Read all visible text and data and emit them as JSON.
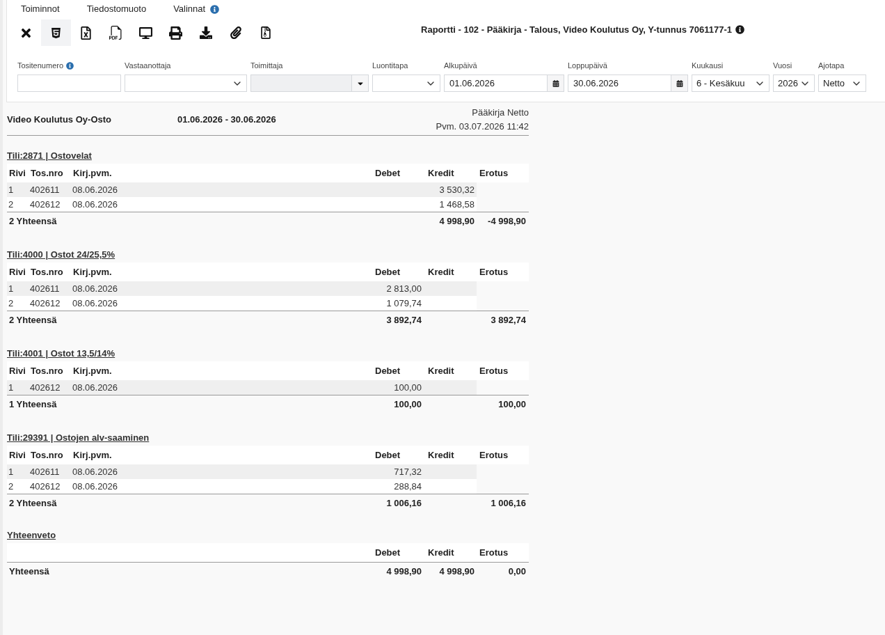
{
  "menu": [
    {
      "label": "Toiminnot",
      "info": false
    },
    {
      "label": "Tiedostomuoto",
      "info": false
    },
    {
      "label": "Valinnat",
      "info": true
    }
  ],
  "toolbar": [
    {
      "kind": "close",
      "selected": false
    },
    {
      "kind": "html",
      "selected": true
    },
    {
      "kind": "excel",
      "selected": false
    },
    {
      "kind": "pdf",
      "selected": false
    },
    {
      "kind": "screen",
      "selected": false
    },
    {
      "kind": "print",
      "selected": false
    },
    {
      "kind": "download",
      "selected": false
    },
    {
      "kind": "attach",
      "selected": false
    },
    {
      "kind": "file",
      "selected": false
    }
  ],
  "title": {
    "text": "Raportti - 102 - Pääkirja - Talous, Video Koulutus Oy, Y-tunnus 7061177-1",
    "info": true
  },
  "filters": [
    {
      "label": "Tositenumero",
      "info": true,
      "kind": "text",
      "disabled": false
    },
    {
      "label": "Vastaanottaja",
      "info": false,
      "kind": "select",
      "disabled": false
    },
    {
      "label": "Toimittaja",
      "info": false,
      "kind": "combo",
      "disabled": true
    },
    {
      "label": "Luontitapa",
      "info": false,
      "kind": "select",
      "disabled": false
    },
    {
      "label": "Alkupäivä",
      "info": false,
      "kind": "date",
      "value": "01.06.2026",
      "disabled": false
    },
    {
      "label": "Loppupäivä",
      "info": false,
      "kind": "date",
      "value": "30.06.2026",
      "disabled": false
    },
    {
      "label": "Kuukausi",
      "info": false,
      "kind": "select",
      "value": "6 - Kesäkuu",
      "disabled": false
    },
    {
      "label": "Vuosi",
      "info": false,
      "kind": "select",
      "value": "2026",
      "disabled": false
    },
    {
      "label": "Ajotapa",
      "info": false,
      "kind": "select",
      "value": "Netto",
      "disabled": false
    }
  ],
  "report": {
    "company": "Video Koulutus Oy-Osto",
    "period": "01.06.2026 - 30.06.2026",
    "report_name": "Pääkirja Netto",
    "printed": "Pvm. 03.07.2026 11:42"
  },
  "accounts": [
    {
      "title": "Tili:2871 | Ostovelat",
      "columns": [
        "Rivi",
        "Tos.nro",
        "Kirj.pvm.",
        "Debet",
        "Kredit",
        "Erotus"
      ],
      "rows": [
        {
          "rivi": "1",
          "tos_nro": "402611",
          "kirj_pvm": "08.06.2026",
          "kredit": "3 530,32"
        },
        {
          "rivi": "2",
          "tos_nro": "402612",
          "kirj_pvm": "08.06.2026",
          "kredit": "1 468,58"
        }
      ],
      "total": {
        "label": "2 Yhteensä",
        "kredit": "4 998,90",
        "erotus": "-4 998,90"
      }
    },
    {
      "title": "Tili:4000 | Ostot 24/25,5%",
      "columns": [
        "Rivi",
        "Tos.nro",
        "Kirj.pvm.",
        "Debet",
        "Kredit",
        "Erotus"
      ],
      "rows": [
        {
          "rivi": "1",
          "tos_nro": "402611",
          "kirj_pvm": "08.06.2026",
          "debet": "2 813,00"
        },
        {
          "rivi": "2",
          "tos_nro": "402612",
          "kirj_pvm": "08.06.2026",
          "debet": "1 079,74"
        }
      ],
      "total": {
        "label": "2 Yhteensä",
        "debet": "3 892,74",
        "erotus": "3 892,74"
      }
    },
    {
      "title": "Tili:4001 | Ostot 13,5/14%",
      "columns": [
        "Rivi",
        "Tos.nro",
        "Kirj.pvm.",
        "Debet",
        "Kredit",
        "Erotus"
      ],
      "rows": [
        {
          "rivi": "1",
          "tos_nro": "402612",
          "kirj_pvm": "08.06.2026",
          "debet": "100,00"
        }
      ],
      "total": {
        "label": "1 Yhteensä",
        "debet": "100,00",
        "erotus": "100,00"
      }
    },
    {
      "title": "Tili:29391 | Ostojen alv-saaminen",
      "columns": [
        "Rivi",
        "Tos.nro",
        "Kirj.pvm.",
        "Debet",
        "Kredit",
        "Erotus"
      ],
      "rows": [
        {
          "rivi": "1",
          "tos_nro": "402611",
          "kirj_pvm": "08.06.2026",
          "debet": "717,32"
        },
        {
          "rivi": "2",
          "tos_nro": "402612",
          "kirj_pvm": "08.06.2026",
          "debet": "288,84"
        }
      ],
      "total": {
        "label": "2 Yhteensä",
        "debet": "1 006,16",
        "erotus": "1 006,16"
      }
    }
  ],
  "summary": {
    "title": "Yhteenveto",
    "columns": [
      "Debet",
      "Kredit",
      "Erotus"
    ],
    "total": {
      "label": "Yhteensä",
      "debet": "4 998,90",
      "kredit": "4 998,90",
      "erotus": "0,00"
    }
  }
}
